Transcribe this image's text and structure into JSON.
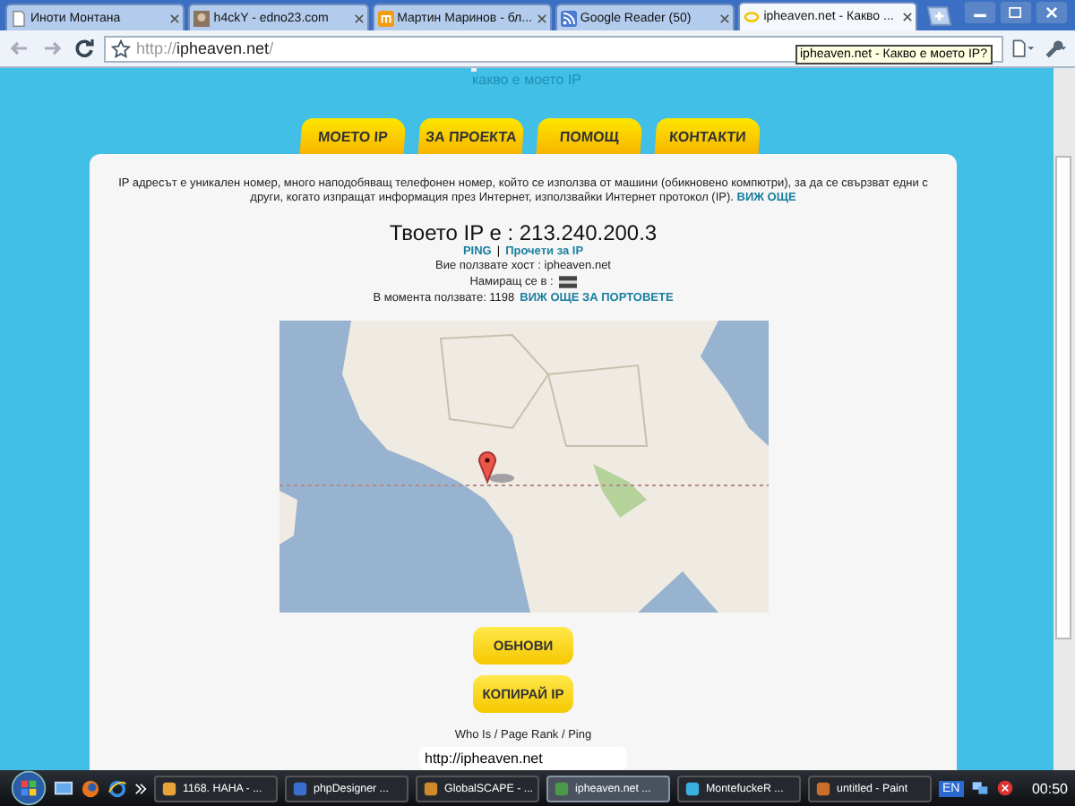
{
  "tabs": [
    {
      "title": "Иноти Монтана",
      "selected": false
    },
    {
      "title": "h4ckY - edno23.com",
      "selected": false
    },
    {
      "title": "Мартин Маринов - бл...",
      "selected": false
    },
    {
      "title": "Google Reader (50)",
      "selected": false
    },
    {
      "title": "ipheaven.net - Какво ...",
      "selected": true
    }
  ],
  "address": {
    "scheme": "http://",
    "host": "ipheaven.net",
    "path": "/"
  },
  "tooltip": "ipheaven.net - Какво е моето IP?",
  "page": {
    "tagline": "какво е моето IP",
    "nav": [
      "МОЕТО IP",
      "ЗА ПРОЕКТА",
      "ПОМОЩ",
      "КОНТАКТИ"
    ],
    "intro": "IP адресът е уникален номер, много наподобяващ телефонен номер, който се използва от машини (обикновено компютри), за да се свързват едни с други, когато изпращат информация през Интернет, използвайки Интернет протокол (IP).",
    "intro_link": "ВИЖ ОЩЕ",
    "ip_heading": "Твоето IP е : 213.240.200.3",
    "links": [
      "PING",
      "Прочети за IP"
    ],
    "link_separator": "|",
    "host_line": "Вие ползвате хост : ipheaven.net",
    "location_label": "Намиращ се в :",
    "ports_label": "В момента ползвате: 1198",
    "ports_link": "ВИЖ ОЩЕ ЗА ПОРТОВЕТЕ",
    "buttons": [
      "ОБНОВИ",
      "КОПИРАЙ IP"
    ],
    "tools_label": "Who Is / Page Rank / Ping",
    "url_field": "http://ipheaven.net"
  },
  "taskbar": {
    "items": [
      {
        "title": "1168. HAHA - ...",
        "selected": false
      },
      {
        "title": "phpDesigner ...",
        "selected": false
      },
      {
        "title": "GlobalSCAPE - ...",
        "selected": false
      },
      {
        "title": "ipheaven.net ...",
        "selected": true
      },
      {
        "title": "MontefuckeR ...",
        "selected": false
      },
      {
        "title": "untitled - Paint",
        "selected": false
      }
    ],
    "language": "EN",
    "clock": "00:50"
  }
}
